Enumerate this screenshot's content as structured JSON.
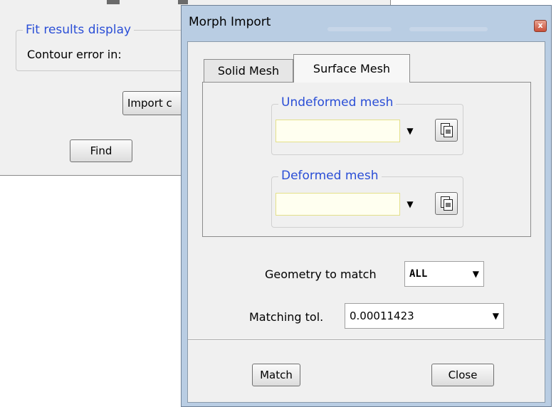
{
  "background_window": {
    "group_title": "Fit results display",
    "contour_label": "Contour error in:",
    "import_button": "Import c",
    "find_button": "Find"
  },
  "dialog": {
    "title": "Morph Import",
    "close_glyph": "x",
    "tabs": [
      "Solid Mesh",
      "Surface Mesh"
    ],
    "active_tab": "Surface Mesh",
    "undeformed": {
      "legend": "Undeformed mesh",
      "value": ""
    },
    "deformed": {
      "legend": "Deformed mesh",
      "value": ""
    },
    "geometry_label": "Geometry to match",
    "geometry_value": "ALL",
    "tolerance_label": "Matching tol.",
    "tolerance_value": "0.00011423",
    "match_button": "Match",
    "close_button": "Close"
  },
  "colors": {
    "group_title": "#2a4ed6",
    "dialog_frame": "#b9cde3",
    "input_background": "#fffff0",
    "close_button": "#c9503a"
  },
  "icons": {
    "dropdown": "dropdown-arrow-icon",
    "browse": "file-browse-icon",
    "close": "close-icon"
  }
}
